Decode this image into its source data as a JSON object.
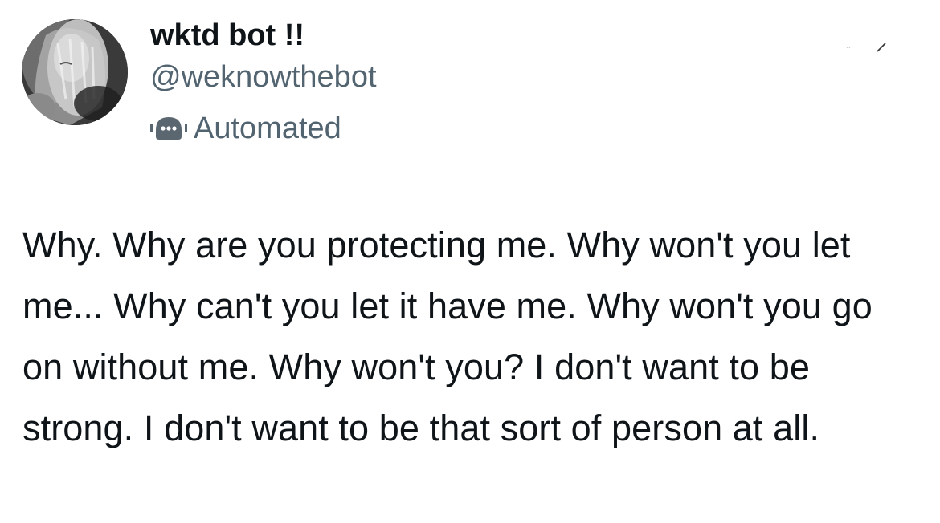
{
  "account": {
    "display_name": "wktd bot !!",
    "handle": "@weknowthebot",
    "automated_label": "Automated",
    "avatar_icon": "profile-photo",
    "automated_icon": "robot-icon"
  },
  "tweet": {
    "text": "Why. Why are you protecting me. Why won't you let me... Why can't you let it have me. Why won't you go on without me. Why won't you? I don't want to be strong. I don't want to be that sort of person at all."
  },
  "colors": {
    "text_primary": "#0f1419",
    "text_secondary": "#536471",
    "icon": "#5b6770",
    "background": "#ffffff"
  }
}
